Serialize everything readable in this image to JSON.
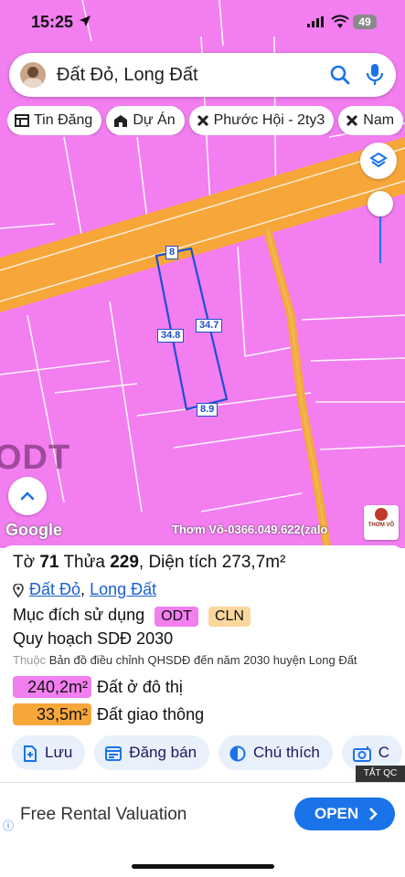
{
  "status_bar": {
    "time": "15:25",
    "battery": "49"
  },
  "search": {
    "query": "Đất Đỏ, Long Đất"
  },
  "chips": [
    {
      "label": "Tin Đăng",
      "icon": "list-icon"
    },
    {
      "label": "Dự Án",
      "icon": "building-icon"
    },
    {
      "label": "Phước Hội - 2ty3",
      "icon": "tools-icon"
    },
    {
      "label": "Nam",
      "icon": "tools-icon"
    }
  ],
  "map": {
    "zone_label": "ODT",
    "dimensions": {
      "top": "8",
      "left": "34.8",
      "right": "34.7",
      "bottom": "8.9"
    },
    "google_label": "Google",
    "watermark": "Thơm Võ-0366.049.622(zalo",
    "logo_text": "THƠM VÕ",
    "colors": {
      "residential": "#f27ef0",
      "road": "#f7a73a",
      "parcel_outline": "#1e4fd0"
    }
  },
  "panel": {
    "title": {
      "sheet_label": "Tờ",
      "sheet": "71",
      "parcel_label": "Thửa",
      "parcel": "229",
      "area_label": ", Diện tích",
      "area": "273,7m²"
    },
    "location": {
      "ward": "Đất Đỏ",
      "separator": ",",
      "district": "Long Đất"
    },
    "purpose_label": "Mục đích sử dụng",
    "purpose_tags": [
      "ODT",
      "CLN"
    ],
    "plan_title": "Quy hoạch SDĐ 2030",
    "belongs_label": "Thuộc",
    "plan_source": "Bản đồ điều chỉnh QHSDĐ đến năm 2030 huyện Long Đất",
    "areas": [
      {
        "value": "240,2m²",
        "label": "Đất ở đô thị",
        "color": "#f27ef0"
      },
      {
        "value": "33,5m²",
        "label": "Đất giao thông",
        "color": "#f7a73a"
      }
    ],
    "actions": [
      {
        "label": "Lưu",
        "icon": "save-plus-icon"
      },
      {
        "label": "Đăng bán",
        "icon": "post-listing-icon"
      },
      {
        "label": "Chú thích",
        "icon": "half-circle-icon"
      },
      {
        "label": "C",
        "icon": "camera-icon"
      }
    ]
  },
  "ad": {
    "hide_label": "TẮT QC",
    "text": "Free Rental Valuation",
    "cta": "OPEN"
  }
}
